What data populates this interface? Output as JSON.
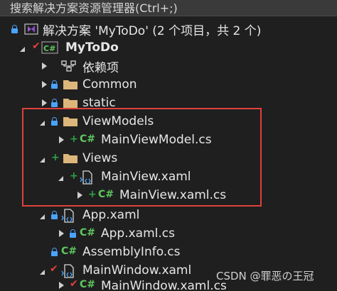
{
  "search": {
    "text": "搜索解决方案资源管理器(Ctrl+;)"
  },
  "tree": {
    "solution": "解决方案 'MyToDo' (2 个项目，共 2 个)",
    "project": "MyToDo",
    "dependencies": "依赖项",
    "common": "Common",
    "static": "static",
    "viewmodels": "ViewModels",
    "mainviewmodel": "MainViewModel.cs",
    "views": "Views",
    "mainview": "MainView.xaml",
    "mainview_cs": "MainView.xaml.cs",
    "app_xaml": "App.xaml",
    "app_cs": "App.xaml.cs",
    "assemblyinfo": "AssemblyInfo.cs",
    "mainwindow": "MainWindow.xaml",
    "mainwindow_cs": "MainWindow.xaml.cs"
  },
  "csharp_glyph": "C#",
  "watermark": "CSDN @罪恶の王冠",
  "colors": {
    "background": "#1f1f1f",
    "lock_blue": "#4aa3ff",
    "add_green": "#2ea043",
    "checkout_red": "#e0413b",
    "folder_yellow": "#dcb67a",
    "highlight": "#e0413b"
  },
  "icons": {
    "solution": "visual-studio-solution-icon",
    "project": "csharp-project-icon",
    "dependencies": "dependencies-icon",
    "folder": "folder-icon",
    "csharp_file": "csharp-file-icon",
    "xaml_file": "xaml-file-icon",
    "lock": "lock-icon",
    "pending_add": "plus-icon",
    "checked_out": "checkmark-icon"
  }
}
